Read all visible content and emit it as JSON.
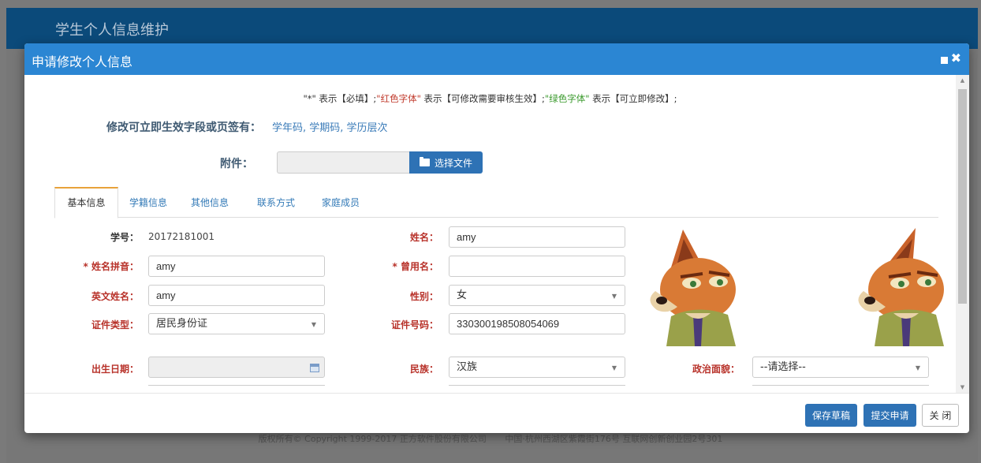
{
  "app": {
    "title": "学生个人信息维护"
  },
  "footer": {
    "copyright": "版权所有© Copyright 1999-2017 正方软件股份有限公司",
    "address": "中国·杭州西湖区紫霞街176号 互联网创新创业园2号301"
  },
  "modal": {
    "title": "申请修改个人信息",
    "note": {
      "part1": "\"*\" 表示【必填】;",
      "red_text": "\"红色字体\"",
      "part2": " 表示【可修改需要审核生效】;",
      "green_text": "\"绿色字体\"",
      "part3": " 表示【可立即修改】;"
    },
    "instant": {
      "label": "修改可立即生效字段或页签有：",
      "value": "学年码, 学期码, 学历层次"
    },
    "attachment": {
      "label": "附件：",
      "button_label": "选择文件"
    }
  },
  "tabs": [
    {
      "label": "基本信息",
      "active": true
    },
    {
      "label": "学籍信息"
    },
    {
      "label": "其他信息"
    },
    {
      "label": "联系方式"
    },
    {
      "label": "家庭成员"
    }
  ],
  "form": {
    "student_id": {
      "label": "学号：",
      "value": "20172181001"
    },
    "name": {
      "label": "姓名：",
      "value": "amy"
    },
    "name_pinyin": {
      "label": "* 姓名拼音：",
      "value": "amy"
    },
    "former_name": {
      "label": "* 曾用名：",
      "value": ""
    },
    "english_name": {
      "label": "英文姓名：",
      "value": "amy"
    },
    "gender": {
      "label": "性别：",
      "value": "女"
    },
    "id_type": {
      "label": "证件类型：",
      "value": "居民身份证"
    },
    "id_number": {
      "label": "证件号码：",
      "value": "330300198508054069"
    },
    "birth_date": {
      "label": "出生日期：",
      "value": ""
    },
    "ethnicity": {
      "label": "民族：",
      "value": "汉族"
    },
    "political_status": {
      "label": "政治面貌：",
      "value": "--请选择--"
    }
  },
  "buttons": {
    "save_draft": "保存草稿",
    "submit": "提交申请",
    "close": "关 闭"
  },
  "colors": {
    "header_blue": "#2b86d3",
    "button_blue": "#2e72b5",
    "label_red": "#b8322a",
    "note_green": "#3a9a2c",
    "tab_accent": "#e8a23a"
  }
}
